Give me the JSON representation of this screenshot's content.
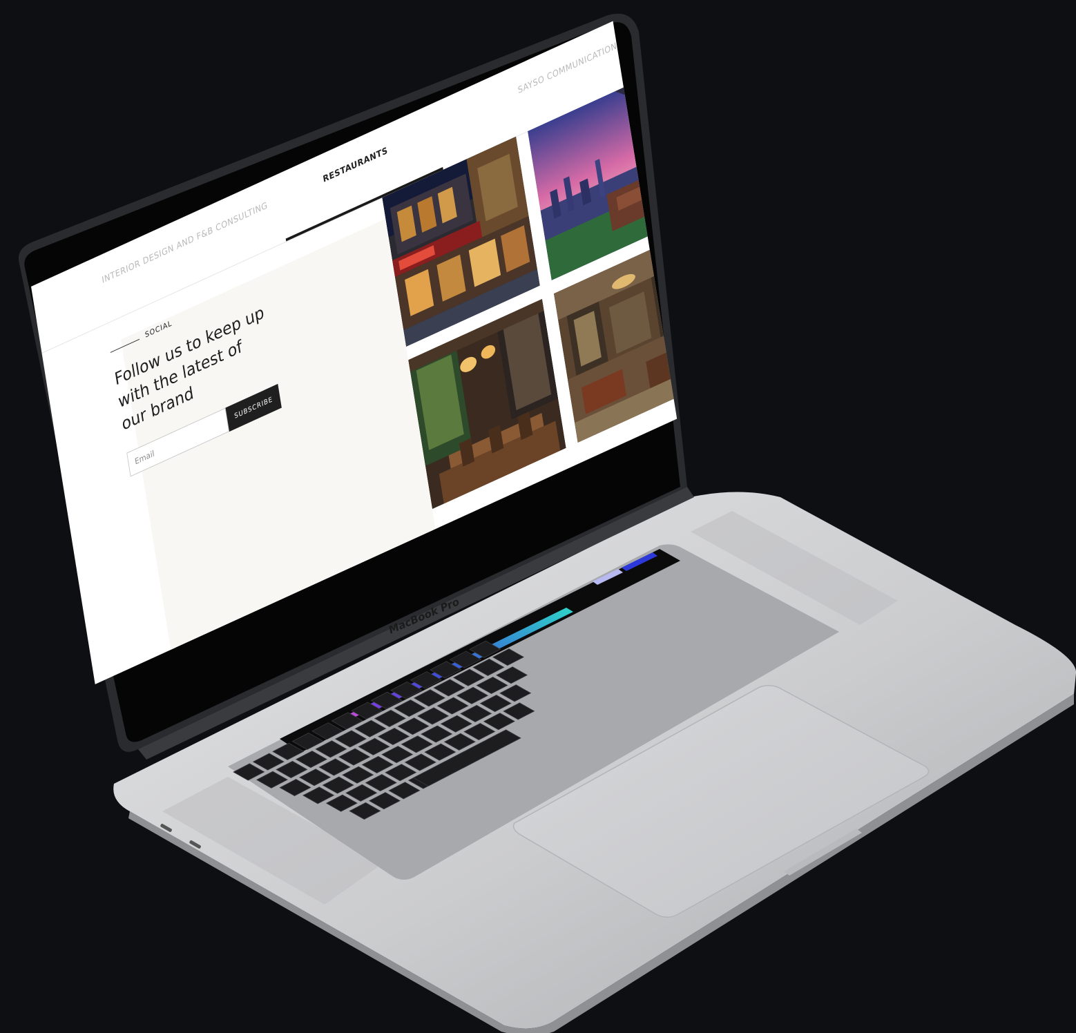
{
  "tabs": {
    "items": [
      {
        "label": "INTERIOR DESIGN AND F&B CONSULTING",
        "active": false
      },
      {
        "label": "RESTAURANTS",
        "active": true
      },
      {
        "label": "SAYSO COMMUNICATIONS",
        "active": false
      }
    ]
  },
  "social": {
    "eyebrow": "SOCIAL",
    "heading": "Follow us to keep up with the latest of our brand",
    "email_placeholder": "Email",
    "subscribe_label": "SUBSCRIBE"
  },
  "gallery": {
    "photos": [
      {
        "subject": "restaurant-exterior"
      },
      {
        "subject": "rooftop-city-view"
      },
      {
        "subject": "dining-room-interior"
      },
      {
        "subject": "classic-lounge-interior"
      }
    ]
  },
  "device": {
    "brand": "MacBook Pro",
    "colors": {
      "background": "#0e0f13",
      "chassis": "#c7c8cb",
      "keys": "#1d1d1f",
      "touchbar_gradient_start": "#3a4fd8",
      "touchbar_gradient_end": "#2fd4c9"
    }
  }
}
